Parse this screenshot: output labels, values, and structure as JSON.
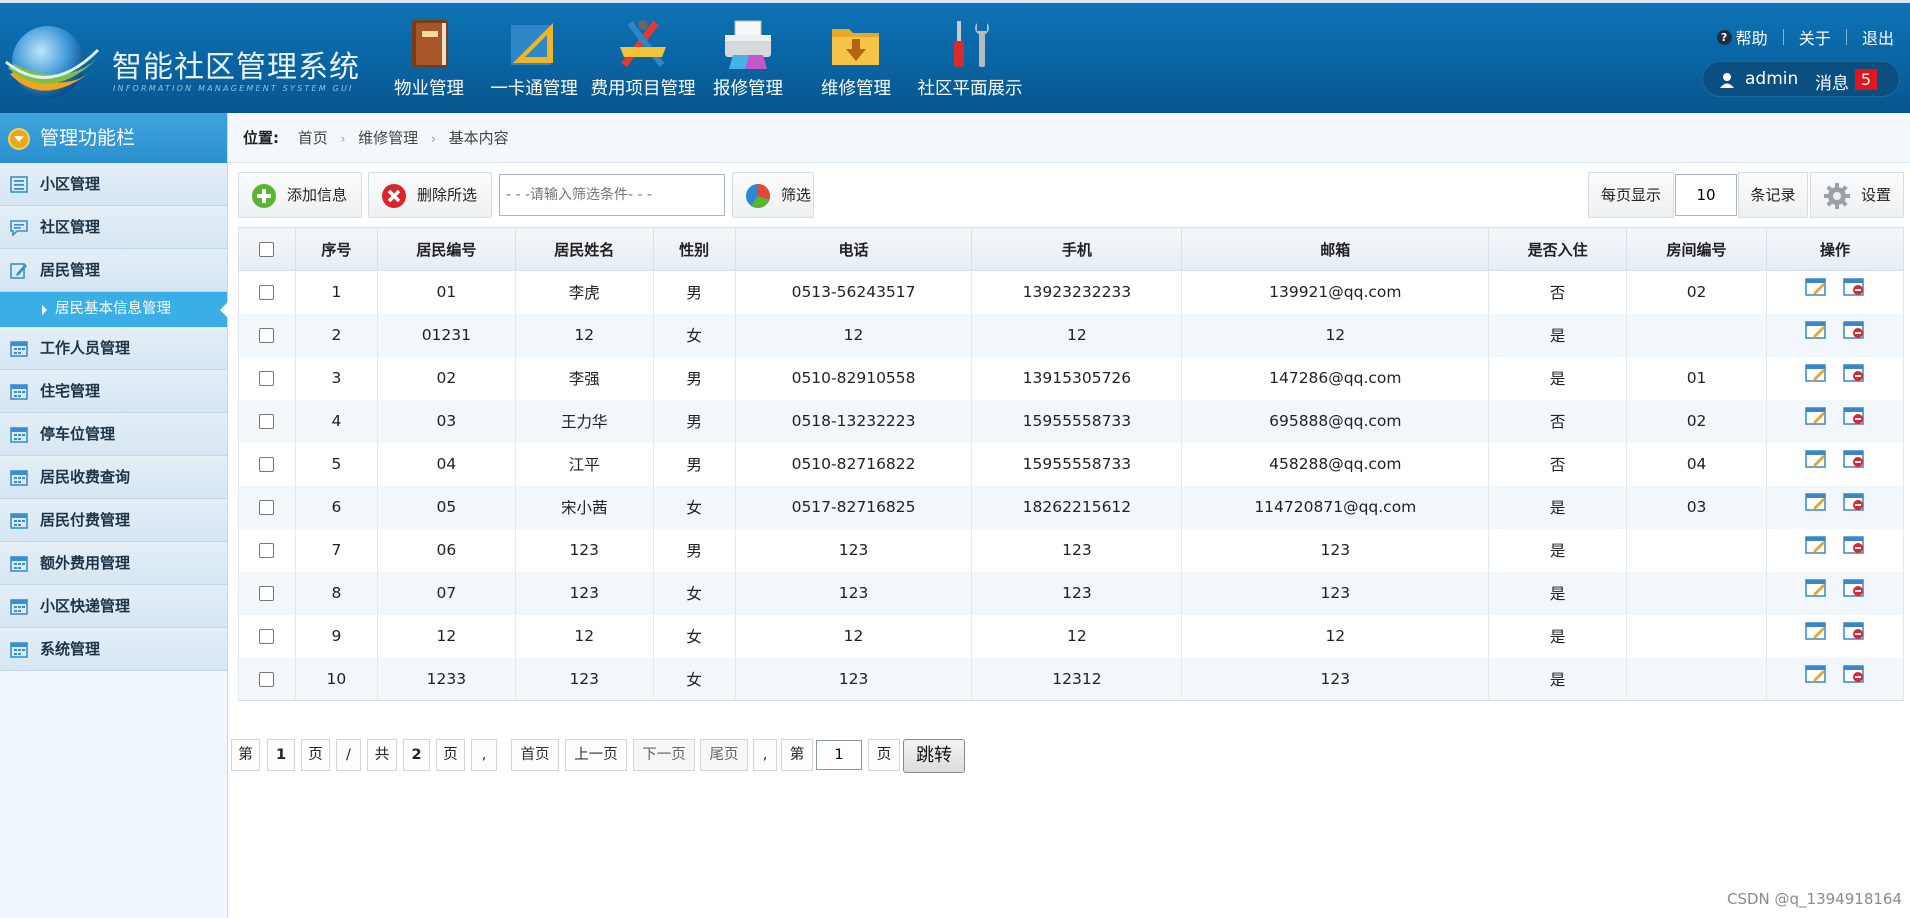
{
  "header": {
    "logo_title": "智能社区管理系统",
    "logo_subtitle": "INFORMATION MANAGEMENT SYSTEM GUI",
    "nav": [
      {
        "label": "物业管理",
        "icon": "book-icon"
      },
      {
        "label": "一卡通管理",
        "icon": "ruler-icon"
      },
      {
        "label": "费用项目管理",
        "icon": "drafting-tools-icon"
      },
      {
        "label": "报修管理",
        "icon": "printer-icon"
      },
      {
        "label": "维修管理",
        "icon": "folder-download-icon"
      },
      {
        "label": "社区平面展示",
        "icon": "screwdriver-wrench-icon"
      }
    ],
    "help": "帮助",
    "about": "关于",
    "logout": "退出",
    "username": "admin",
    "messages_label": "消息",
    "messages_count": "5"
  },
  "sidebar": {
    "title": "管理功能栏",
    "items": [
      {
        "label": "小区管理",
        "icon": "list-icon"
      },
      {
        "label": "社区管理",
        "icon": "chat-icon"
      },
      {
        "label": "居民管理",
        "icon": "edit-icon"
      },
      {
        "label": "居民基本信息管理",
        "sub": true
      },
      {
        "label": "工作人员管理",
        "icon": "calendar-icon"
      },
      {
        "label": "住宅管理",
        "icon": "calendar-icon"
      },
      {
        "label": "停车位管理",
        "icon": "calendar-icon"
      },
      {
        "label": "居民收费查询",
        "icon": "calendar-icon"
      },
      {
        "label": "居民付费管理",
        "icon": "calendar-icon"
      },
      {
        "label": "额外费用管理",
        "icon": "calendar-icon"
      },
      {
        "label": "小区快递管理",
        "icon": "calendar-icon"
      },
      {
        "label": "系统管理",
        "icon": "calendar-icon"
      }
    ]
  },
  "breadcrumb": {
    "label": "位置:",
    "items": [
      "首页",
      "维修管理",
      "基本内容"
    ]
  },
  "toolbar": {
    "add_label": "添加信息",
    "delete_label": "删除所选",
    "filter_placeholder": "- - -请输入筛选条件- - -",
    "filter_label": "筛选",
    "per_page_label": "每页显示",
    "per_page_value": "10",
    "records_label": "条记录",
    "settings_label": "设置"
  },
  "table": {
    "columns": [
      "",
      "序号",
      "居民编号",
      "居民姓名",
      "性别",
      "电话",
      "手机",
      "邮箱",
      "是否入住",
      "房间编号",
      "操作"
    ],
    "rows": [
      [
        "1",
        "01",
        "李虎",
        "男",
        "0513-56243517",
        "13923232233",
        "139921@qq.com",
        "否",
        "02"
      ],
      [
        "2",
        "01231",
        "12",
        "女",
        "12",
        "12",
        "12",
        "是",
        ""
      ],
      [
        "3",
        "02",
        "李强",
        "男",
        "0510-82910558",
        "13915305726",
        "147286@qq.com",
        "是",
        "01"
      ],
      [
        "4",
        "03",
        "王力华",
        "男",
        "0518-13232223",
        "15955558733",
        "695888@qq.com",
        "否",
        "02"
      ],
      [
        "5",
        "04",
        "江平",
        "男",
        "0510-82716822",
        "15955558733",
        "458288@qq.com",
        "否",
        "04"
      ],
      [
        "6",
        "05",
        "宋小茜",
        "女",
        "0517-82716825",
        "18262215612",
        "114720871@qq.com",
        "是",
        "03"
      ],
      [
        "7",
        "06",
        "123",
        "男",
        "123",
        "123",
        "123",
        "是",
        ""
      ],
      [
        "8",
        "07",
        "123",
        "女",
        "123",
        "123",
        "123",
        "是",
        ""
      ],
      [
        "9",
        "12",
        "12",
        "女",
        "12",
        "12",
        "12",
        "是",
        ""
      ],
      [
        "10",
        "1233",
        "123",
        "女",
        "123",
        "12312",
        "123",
        "是",
        ""
      ]
    ]
  },
  "pager": {
    "di": "第",
    "current": "1",
    "ye": "页",
    "slash": "/",
    "gong": "共",
    "total": "2",
    "comma": ",",
    "first": "首页",
    "prev": "上一页",
    "next": "下一页",
    "last": "尾页",
    "jump_value": "1",
    "go": "跳转"
  },
  "watermark": "CSDN @q_1394918164"
}
